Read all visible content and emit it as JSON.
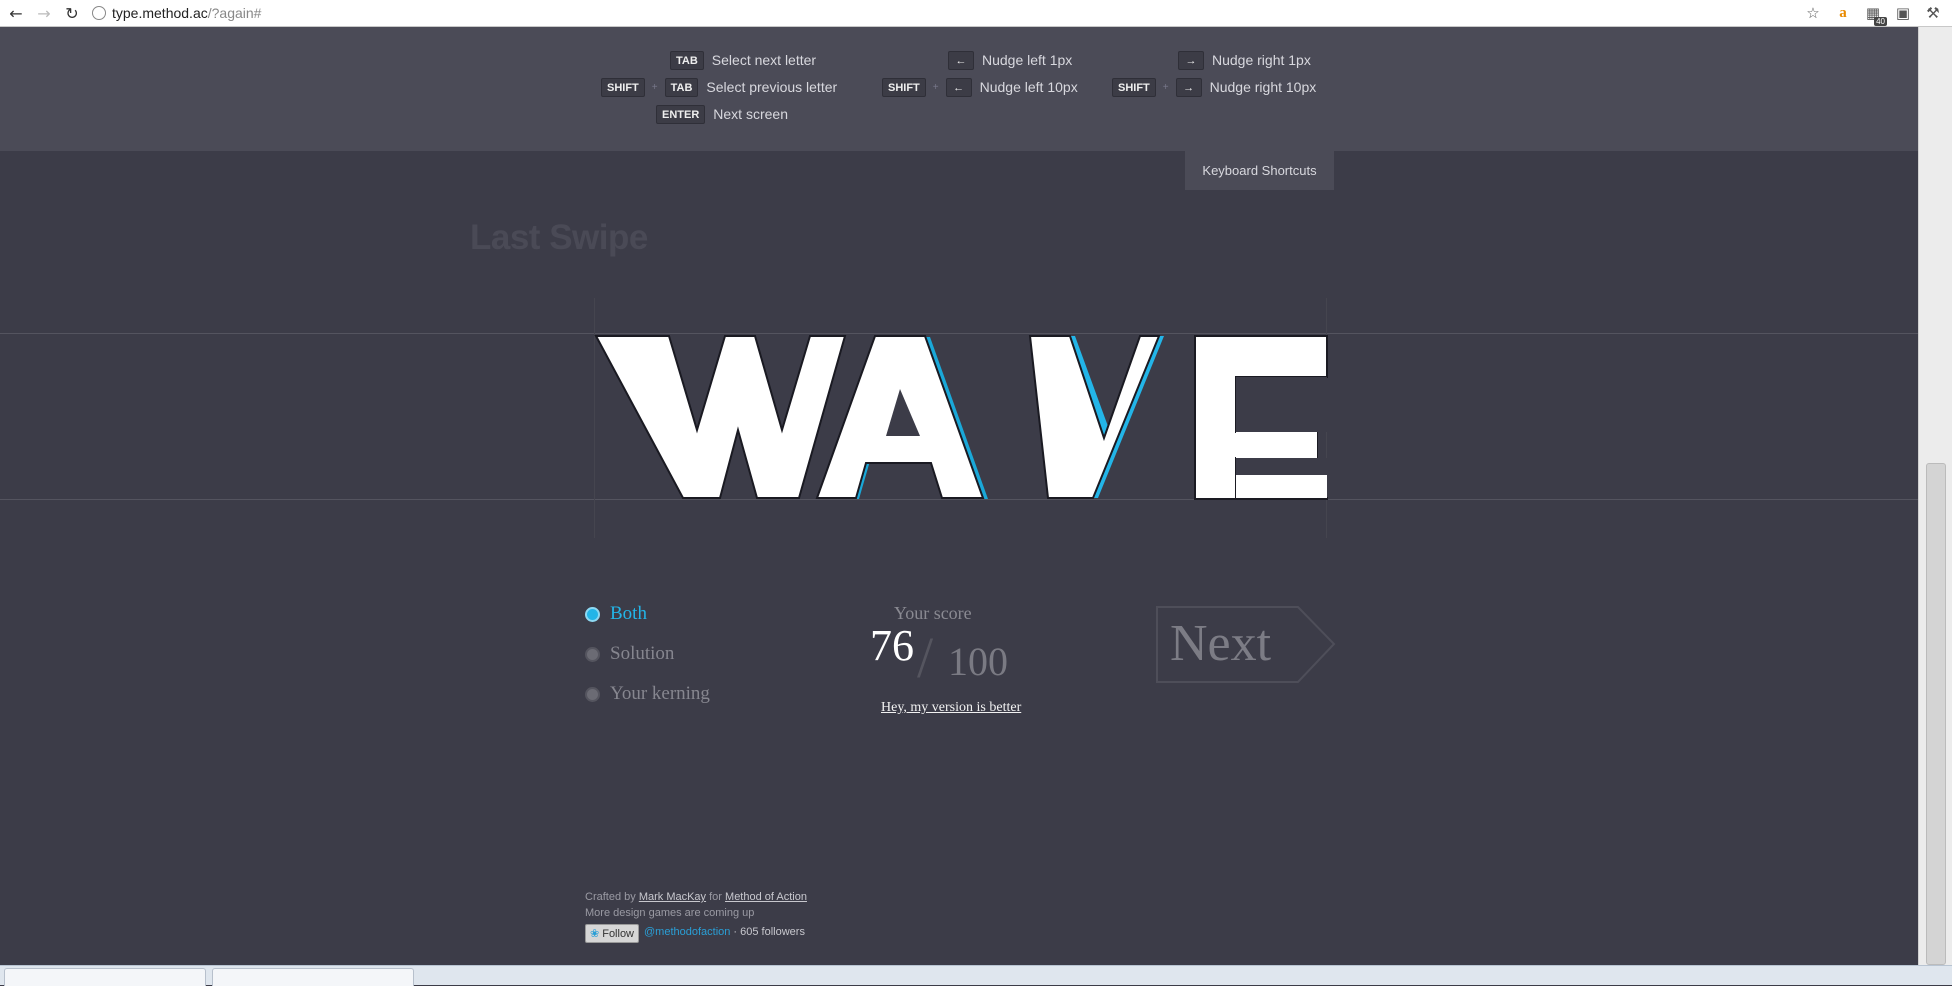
{
  "browser": {
    "url_host": "type.method.ac",
    "url_path": "/?again#",
    "extension_badge": "40"
  },
  "shortcuts": {
    "col1": [
      {
        "keys": [
          "TAB"
        ],
        "label": "Select next letter"
      },
      {
        "keys": [
          "SHIFT",
          "TAB"
        ],
        "label": "Select previous letter"
      },
      {
        "keys": [
          "ENTER"
        ],
        "label": "Next screen"
      }
    ],
    "col2": [
      {
        "keys": [
          "←"
        ],
        "label": "Nudge left 1px"
      },
      {
        "keys": [
          "SHIFT",
          "←"
        ],
        "label": "Nudge left 10px"
      }
    ],
    "col3": [
      {
        "keys": [
          "→"
        ],
        "label": "Nudge right 1px"
      },
      {
        "keys": [
          "SHIFT",
          "→"
        ],
        "label": "Nudge right 10px"
      }
    ],
    "plus": "+",
    "toggle_label": "Keyboard Shortcuts"
  },
  "level": {
    "title": "Last Swipe",
    "word": "WAVE"
  },
  "view_options": {
    "both": "Both",
    "solution": "Solution",
    "your_kerning": "Your kerning",
    "selected": "Both"
  },
  "score": {
    "label": "Your score",
    "value": "76",
    "separator": "/",
    "out_of": "100",
    "dispute_link": "Hey, my version is better"
  },
  "next_button": "Next",
  "footer": {
    "crafted_by": "Crafted by",
    "author": "Mark MacKay",
    "for_text": "for",
    "company": "Method of Action",
    "more_games": "More design games are coming up",
    "follow_label": "Follow",
    "twitter_handle": "@methodofaction",
    "followers": "· 605 followers"
  },
  "colors": {
    "background": "#3c3c48",
    "panel": "#4b4b57",
    "accent": "#23b5e8",
    "letters": "#ffffff"
  }
}
